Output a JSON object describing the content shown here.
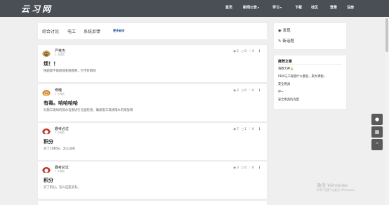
{
  "header": {
    "logo": "云习网",
    "nav": [
      {
        "label": "首页",
        "caret": ""
      },
      {
        "label": "新闻公告",
        "caret": "▾"
      },
      {
        "label": "学习",
        "caret": "▾"
      },
      {
        "label": "下载",
        "caret": ""
      },
      {
        "label": "社区",
        "caret": ""
      },
      {
        "label": "登录",
        "caret": ""
      },
      {
        "label": "注册",
        "caret": ""
      }
    ]
  },
  "tabs": {
    "items": [
      "综合讨论",
      "电工",
      "系统反馈"
    ],
    "more": "更多板块"
  },
  "posts": [
    {
      "user": "严英杰",
      "time": "2 小时前",
      "views": "2",
      "comments": "0",
      "likes": "0",
      "title": "烦！！",
      "excerpt": "搜题能不能刷或者搜题啊，打字好麻烦"
    },
    {
      "user": "奇魄",
      "time": "2 小时前",
      "views": "2",
      "comments": "0",
      "likes": "0",
      "title": "有毒。哈哈哈哈",
      "excerpt": "对施工现场的排水设施进行全面检查，确保施工现场雨水的排放和"
    },
    {
      "user": "趣考必过",
      "time": "7 小时前",
      "views": "7",
      "comments": "1",
      "likes": "0",
      "title": "积分",
      "excerpt": "买了10积分，怎么没有"
    },
    {
      "user": "趣考必过",
      "time": "7 小时前",
      "views": "3",
      "comments": "0",
      "likes": "0",
      "title": "积分",
      "excerpt": "买了积分，怎么还是没有。"
    }
  ],
  "sidebar": {
    "post_label": "发现",
    "newtopic_label": "新话题",
    "rec_title": "推荐文章",
    "rec_items": [
      "请教大神🙏",
      "PDX与工商管什么意思，来大神指...",
      "安全用具",
      "哼~",
      "安全用具的深度"
    ]
  },
  "watermark": {
    "line1": "激活 Windows",
    "line2": "转到\"设置\"以激活 Windows。"
  },
  "colors": {
    "header_bg": "#4a4f55",
    "page_bg": "#efefef",
    "link_blue": "#1e4a8f"
  }
}
